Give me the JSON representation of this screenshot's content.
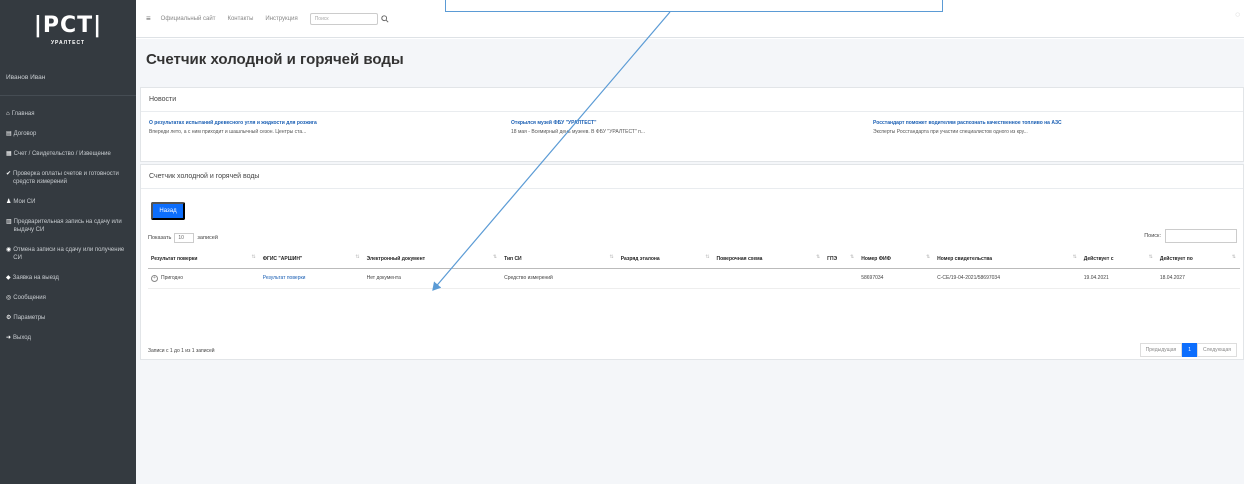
{
  "sidebar": {
    "logo": "|PCT|",
    "logo_sub": "УРАЛТЕСТ",
    "user": "Иванов Иван",
    "items": [
      {
        "icon": "home-icon",
        "glyph": "⌂",
        "label": "Главная"
      },
      {
        "icon": "document-icon",
        "glyph": "▤",
        "label": "Договор"
      },
      {
        "icon": "invoice-icon",
        "glyph": "▦",
        "label": "Счет / Свидетельство / Извещение"
      },
      {
        "icon": "check-icon",
        "glyph": "✔",
        "label": "Проверка оплаты счетов и готовности средств измерений"
      },
      {
        "icon": "user-icon",
        "glyph": "♟",
        "label": "Мои СИ"
      },
      {
        "icon": "calendar-icon",
        "glyph": "▥",
        "label": "Предварительная запись на сдачу или выдачу СИ"
      },
      {
        "icon": "cancel-icon",
        "glyph": "◉",
        "label": "Отмена записи на сдачу или получение СИ"
      },
      {
        "icon": "car-icon",
        "glyph": "◆",
        "label": "Заявка на выезд"
      },
      {
        "icon": "message-icon",
        "glyph": "◎",
        "label": "Сообщения"
      },
      {
        "icon": "settings-icon",
        "glyph": "⚙",
        "label": "Параметры"
      },
      {
        "icon": "logout-icon",
        "glyph": "➜",
        "label": "Выход"
      }
    ]
  },
  "topbar": {
    "links": [
      "Официальный сайт",
      "Контакты",
      "Инструкция"
    ],
    "search_placeholder": "Поиск"
  },
  "page": {
    "title": "Счетчик холодной и горячей воды"
  },
  "news": {
    "header": "Новости",
    "items": [
      {
        "title": "О результатах испытаний древесного угля и жидкости для розжига",
        "desc": "Впереди лето, а с ним приходит и шашлычный сезон. Центры ста..."
      },
      {
        "title": "Открылся музей ФБУ \"УРАЛТЕСТ\"",
        "desc": "18 мая - Всемирный день музеев. В ФБУ \"УРАЛТЕСТ\" п..."
      },
      {
        "title": "Росстандарт поможет водителям распознать качественное топливо на АЗС",
        "desc": "Эксперты Росстандарта при участии специалистов одного из кру..."
      }
    ]
  },
  "main": {
    "header": "Счетчик холодной и горячей воды",
    "back_button": "Назад",
    "show_label": "Показать",
    "show_value": "10",
    "records_label": "записей",
    "search_label": "Поиск:",
    "columns": [
      "Результат поверки",
      "ФГИС \"АРШИН\"",
      "Электронный документ",
      "Тип СИ",
      "Разряд эталона",
      "Поверочная схема",
      "ГПЭ",
      "Номер ФИФ",
      "Номер свидетельства",
      "Действует с",
      "Действует по"
    ],
    "rows": [
      [
        "Пригодно",
        "Результат поверки",
        "Нет документа",
        "Средство измерений",
        "",
        "",
        "",
        "58697034",
        "С-СЕ/19-04-2021/58697034",
        "19.04.2021",
        "18.04.2027"
      ]
    ],
    "records_info": "Записи с 1 до 1 из 1 записей",
    "pager": {
      "prev": "Предыдущая",
      "page": "1",
      "next": "Следующая"
    }
  },
  "colors": {
    "sidebar": "#343a40",
    "accent": "#0d6efd",
    "link": "#1a5fb4",
    "annotation": "#5b9bd5"
  }
}
